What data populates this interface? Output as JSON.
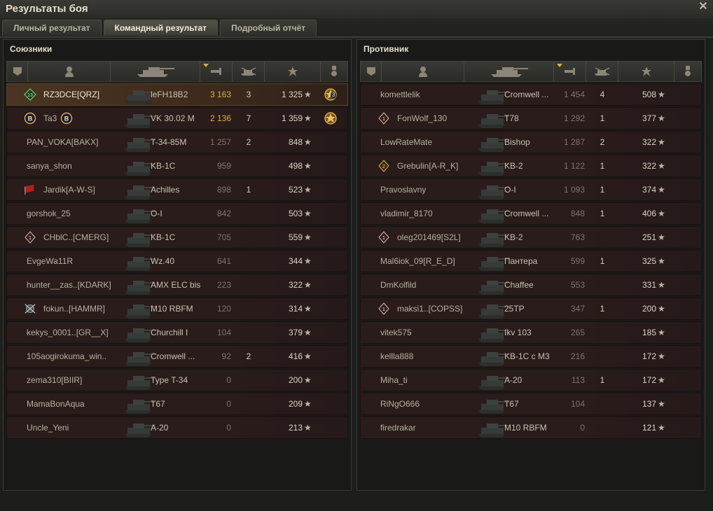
{
  "window": {
    "title": "Результаты боя"
  },
  "tabs": [
    {
      "label": "Личный результат"
    },
    {
      "label": "Командный результат"
    },
    {
      "label": "Подробный отчёт"
    }
  ],
  "allies": {
    "title": "Союзники",
    "players": [
      {
        "name": "RZ3DCE[QRZ]",
        "tank": "leFH18B2",
        "damage": "3 163",
        "kills": "3",
        "xp": "1 325",
        "icon": "badge-13-icon",
        "medal": "3",
        "highlight": true,
        "gold": true
      },
      {
        "name": "Ta3",
        "tank": "VK 30.02 M",
        "damage": "2 136",
        "kills": "7",
        "xp": "1 359",
        "icon": "badge-b-icon",
        "suffix_icon": "badge-b-icon",
        "medal": "",
        "highlight": false,
        "gold": true
      },
      {
        "name": "PAN_VOKA[BAKX]",
        "tank": "T-34-85M",
        "damage": "1 257",
        "kills": "2",
        "xp": "848"
      },
      {
        "name": "sanya_shon",
        "tank": "KB-1C",
        "damage": "959",
        "kills": "",
        "xp": "498"
      },
      {
        "name": "Jardik[A-W-S]",
        "tank": "Achilles",
        "damage": "898",
        "kills": "1",
        "xp": "523",
        "icon": "flag-icon"
      },
      {
        "name": "gorshok_25",
        "tank": "O-I",
        "damage": "842",
        "kills": "",
        "xp": "503"
      },
      {
        "name": "CHblC..[CMERG]",
        "tank": "KB-1C",
        "damage": "705",
        "kills": "",
        "xp": "559",
        "icon": "badge-1-icon"
      },
      {
        "name": "EvgeWa11R",
        "tank": "Wz.40",
        "damage": "641",
        "kills": "",
        "xp": "344"
      },
      {
        "name": "hunter__zas..[KDARK]",
        "tank": "AMX ELC bis",
        "damage": "223",
        "kills": "",
        "xp": "322"
      },
      {
        "name": "fokun..[HAMMR]",
        "tank": "M10 RBFM",
        "damage": "120",
        "kills": "",
        "xp": "314",
        "icon": "clan-emblem-icon"
      },
      {
        "name": "kekys_0001..[GR__X]",
        "tank": "Churchill I",
        "damage": "104",
        "kills": "",
        "xp": "379"
      },
      {
        "name": "105aogirokuma_win..",
        "tank": "Cromwell ...",
        "damage": "92",
        "kills": "2",
        "xp": "416"
      },
      {
        "name": "zema310[BIIR]",
        "tank": "Type T-34",
        "damage": "0",
        "kills": "",
        "xp": "200"
      },
      {
        "name": "MamaBonAqua",
        "tank": "T67",
        "damage": "0",
        "kills": "",
        "xp": "209"
      },
      {
        "name": "Uncle_Yeni",
        "tank": "A-20",
        "damage": "0",
        "kills": "",
        "xp": "213"
      }
    ]
  },
  "enemies": {
    "title": "Противник",
    "players": [
      {
        "name": "komettlelik",
        "tank": "Cromwell ...",
        "damage": "1 454",
        "kills": "4",
        "xp": "508"
      },
      {
        "name": "FonWolf_130",
        "tank": "T78",
        "damage": "1 292",
        "kills": "1",
        "xp": "377",
        "icon": "badge-1-icon"
      },
      {
        "name": "LowRateMate",
        "tank": "Bishop",
        "damage": "1 287",
        "kills": "2",
        "xp": "322"
      },
      {
        "name": "Grebulin[A-R_K]",
        "tank": "KB-2",
        "damage": "1 122",
        "kills": "1",
        "xp": "322",
        "icon": "badge-2-icon"
      },
      {
        "name": "Pravoslavny",
        "tank": "O-I",
        "damage": "1 093",
        "kills": "1",
        "xp": "374"
      },
      {
        "name": "vladimir_8170",
        "tank": "Cromwell ...",
        "damage": "848",
        "kills": "1",
        "xp": "406"
      },
      {
        "name": "oleg201469[S2L]",
        "tank": "KB-2",
        "damage": "763",
        "kills": "",
        "xp": "251",
        "icon": "badge-1-icon"
      },
      {
        "name": "Mal6iok_09[R_E_D]",
        "tank": "Пантера",
        "damage": "599",
        "kills": "1",
        "xp": "325"
      },
      {
        "name": "DmKolfild",
        "tank": "Chaffee",
        "damage": "553",
        "kills": "",
        "xp": "331"
      },
      {
        "name": "maksi1..[COPSS]",
        "tank": "25TP",
        "damage": "347",
        "kills": "1",
        "xp": "200",
        "icon": "badge-1-icon"
      },
      {
        "name": "vitek575",
        "tank": "Ikv 103",
        "damage": "265",
        "kills": "",
        "xp": "185"
      },
      {
        "name": "kellla888",
        "tank": "KB-1C c M3",
        "damage": "216",
        "kills": "",
        "xp": "172"
      },
      {
        "name": "Miha_ti",
        "tank": "A-20",
        "damage": "113",
        "kills": "1",
        "xp": "172"
      },
      {
        "name": "RiNgO666",
        "tank": "T67",
        "damage": "104",
        "kills": "",
        "xp": "137"
      },
      {
        "name": "firedrakar",
        "tank": "M10 RBFM",
        "damage": "0",
        "kills": "",
        "xp": "121"
      }
    ]
  },
  "colors": {
    "gold": "#d9b048",
    "row_bg": "#2a1c1a",
    "row_highlight": "#4a3522",
    "header_bg": "#393a35"
  },
  "icons": {
    "star": "★",
    "close": "✕"
  }
}
